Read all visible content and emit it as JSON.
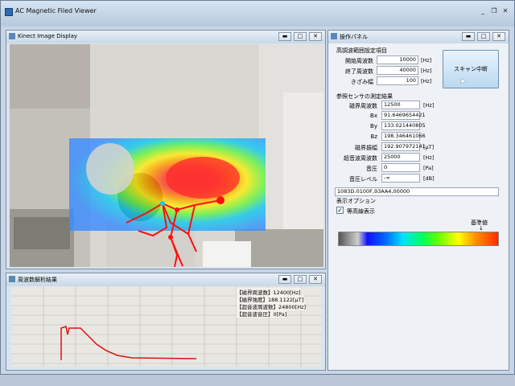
{
  "app": {
    "title": "AC Magnetic Filed Viewer",
    "minimize": "_",
    "restore": "❐",
    "close": "✕"
  },
  "kinect": {
    "title": "Kinect Image Display",
    "btn_min": "▬",
    "btn_max": "□",
    "btn_close": "✕"
  },
  "panel": {
    "title": "操作パネル",
    "btn_min": "▬",
    "btn_max": "□",
    "btn_close": "✕",
    "scan_section": {
      "heading": "高調波範囲設定項目",
      "start_label": "開始周波数",
      "start_value": "10000",
      "start_unit": "[Hz]",
      "end_label": "終了周波数",
      "end_value": "40000",
      "end_unit": "[Hz]",
      "step_label": "きざみ幅",
      "step_value": "100",
      "step_unit": "[Hz]"
    },
    "scan_button": "スキャン中断",
    "result_section": {
      "heading": "参照センサの測定結果",
      "freq_label": "磁界周波数",
      "freq_value": "12500",
      "freq_unit": "[Hz]",
      "bx_label": "Bx",
      "bx_value": "91.6469654421",
      "by_label": "By",
      "by_value": "133.021440805",
      "bz_label": "Bz",
      "bz_value": "198.346461066",
      "amp_label": "磁界振幅",
      "amp_value": "192.907972141",
      "amp_unit": "[μT]",
      "sound_freq_label": "超音波周波数",
      "sound_freq_value": "25000",
      "sound_freq_unit": "[Hz]",
      "pressure_label": "音圧",
      "pressure_value": "0",
      "pressure_unit": "[Pa]",
      "level_label": "音圧レベル",
      "level_value": "-∞",
      "level_unit": "[dB]"
    },
    "serial_line": "1083D.0100F,93AA4,00000",
    "options": {
      "heading": "表示オプション",
      "checkbox_label": "等高線表示",
      "checked": true
    },
    "threshold_label": "基準値"
  },
  "spectrum": {
    "title": "周波数解析結果",
    "btn_min": "▬",
    "btn_max": "□",
    "btn_close": "✕",
    "readouts": [
      "【磁界周波数】12400[Hz]",
      "【磁界強度】188.1122[μT]",
      "【超音波周波数】24800[Hz]",
      "【超音波音圧】0[Pa]"
    ]
  }
}
